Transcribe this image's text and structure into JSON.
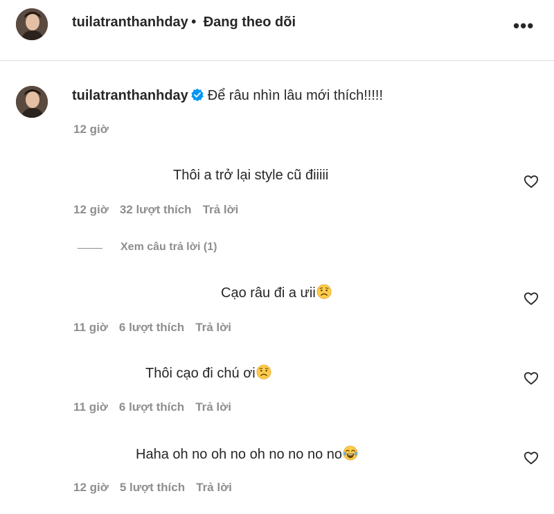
{
  "header": {
    "username": "tuilatranthanhday",
    "separator": "•",
    "follow_status": "Đang theo dõi",
    "more_icon": "more-horizontal-icon"
  },
  "caption": {
    "username": "tuilatranthanhday",
    "verified_icon": "verified-badge-icon",
    "text": "Để râu nhìn lâu mới thích!!!!!",
    "time": "12 giờ"
  },
  "comments": [
    {
      "text": "Thôi a trở lại style cũ điiiii",
      "emoji": "",
      "time": "12 giờ",
      "likes": "32 lượt thích",
      "reply": "Trả lời",
      "view_replies": "Xem câu trả lời (1)"
    },
    {
      "text": "Cạo râu đi a ưii",
      "emoji": "worried-face",
      "time": "11 giờ",
      "likes": "6 lượt thích",
      "reply": "Trả lời"
    },
    {
      "text": "Thôi cạo đi chú ơi",
      "emoji": "worried-face",
      "time": "11 giờ",
      "likes": "6 lượt thích",
      "reply": "Trả lời"
    },
    {
      "text": "Haha oh no oh no oh no no no no",
      "emoji": "tears-of-joy-face",
      "time": "12 giờ",
      "likes": "5 lượt thích",
      "reply": "Trả lời"
    }
  ],
  "colors": {
    "text": "#262626",
    "secondary": "#8e8e8e",
    "verified": "#0095f6",
    "divider": "#dbdbdb"
  }
}
